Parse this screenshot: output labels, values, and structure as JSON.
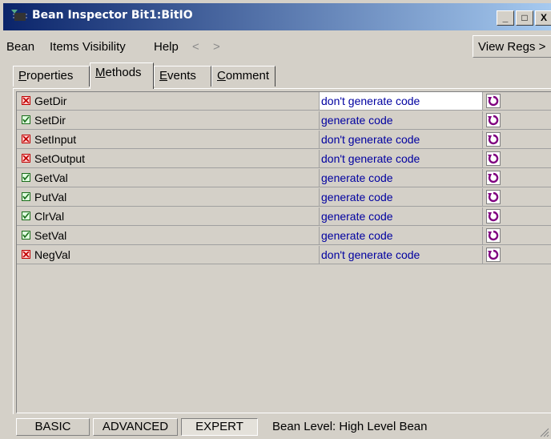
{
  "window": {
    "title": "Bean Inspector Bit1:BitIO",
    "min_label": "_",
    "max_label": "□",
    "close_label": "X",
    "title_color": "#0a246a"
  },
  "menu": {
    "items": [
      "Bean",
      "Items Visibility",
      "Help"
    ],
    "back_arrow": "<",
    "forward_arrow": ">",
    "view_regs": "View Regs >"
  },
  "tabs": [
    {
      "label": "Properties",
      "underline": "P",
      "rest": "roperties",
      "active": false
    },
    {
      "label": "Methods",
      "underline": "M",
      "rest": "ethods",
      "active": true
    },
    {
      "label": "Events",
      "underline": "E",
      "rest": "vents",
      "active": false
    },
    {
      "label": "Comment",
      "underline": "C",
      "rest": "omment",
      "active": false
    }
  ],
  "methods": [
    {
      "name": "GetDir",
      "value": "don't generate code",
      "enabled": false,
      "selected": true
    },
    {
      "name": "SetDir",
      "value": "generate code",
      "enabled": true,
      "selected": false
    },
    {
      "name": "SetInput",
      "value": "don't generate code",
      "enabled": false,
      "selected": false
    },
    {
      "name": "SetOutput",
      "value": "don't generate code",
      "enabled": false,
      "selected": false
    },
    {
      "name": "GetVal",
      "value": "generate code",
      "enabled": true,
      "selected": false
    },
    {
      "name": "PutVal",
      "value": "generate code",
      "enabled": true,
      "selected": false
    },
    {
      "name": "ClrVal",
      "value": "generate code",
      "enabled": true,
      "selected": false
    },
    {
      "name": "SetVal",
      "value": "generate code",
      "enabled": true,
      "selected": false
    },
    {
      "name": "NegVal",
      "value": "don't generate code",
      "enabled": false,
      "selected": false
    }
  ],
  "bottom": {
    "basic": "BASIC",
    "advanced": "ADVANCED",
    "expert": "EXPERT",
    "bean_level": "Bean Level: High Level Bean"
  },
  "colors": {
    "value_text": "#0000a0",
    "reset_icon": "#800080",
    "enabled_check": "#1a6b1a",
    "disabled_check": "#c00000"
  }
}
